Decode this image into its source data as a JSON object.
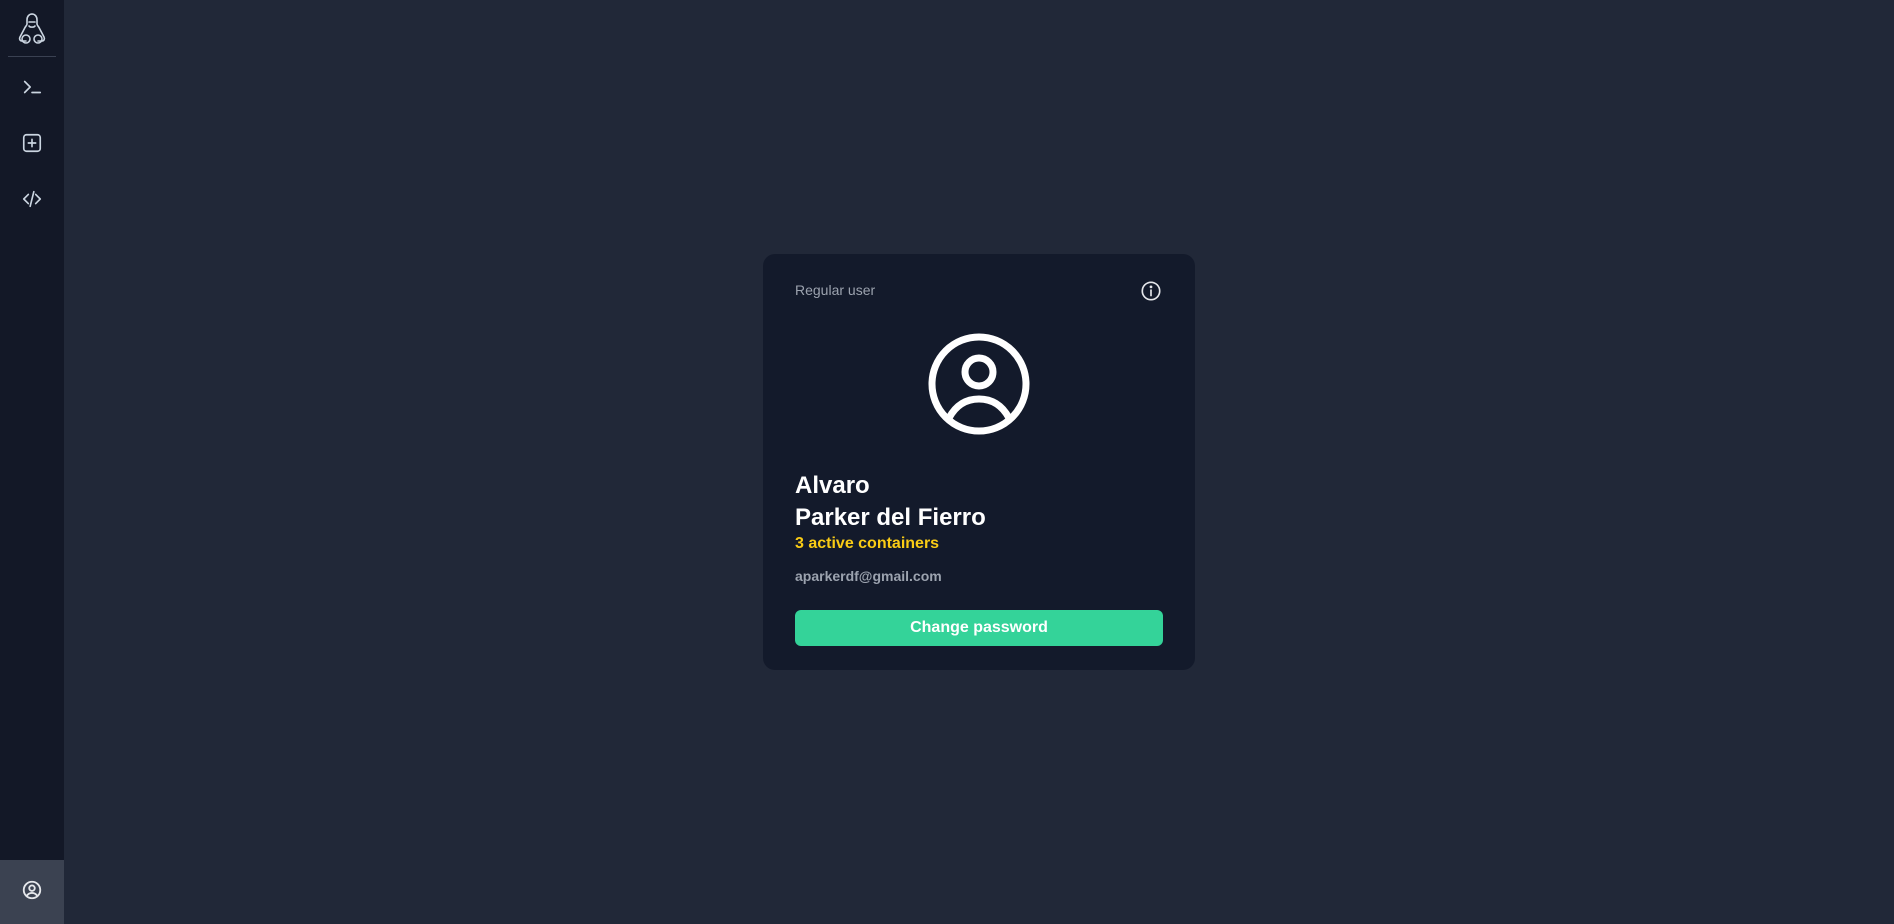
{
  "sidebar": {
    "logo_icon": "penguin-logo-icon",
    "nav": [
      {
        "icon": "terminal-icon"
      },
      {
        "icon": "plus-square-icon"
      },
      {
        "icon": "code-icon"
      }
    ],
    "account_icon": "user-circle-icon"
  },
  "card": {
    "role": "Regular user",
    "info_icon": "info-circle-icon",
    "avatar_icon": "user-circle-icon",
    "first_name": "Alvaro",
    "last_name": "Parker del Fierro",
    "containers": "3 active containers",
    "email": "aparkerdf@gmail.com",
    "change_password_label": "Change password"
  },
  "colors": {
    "background": "#212838",
    "sidebar": "#131827",
    "card": "#131a2b",
    "accent": "#34d399",
    "highlight": "#facc15",
    "muted_text": "#9ca3af"
  }
}
